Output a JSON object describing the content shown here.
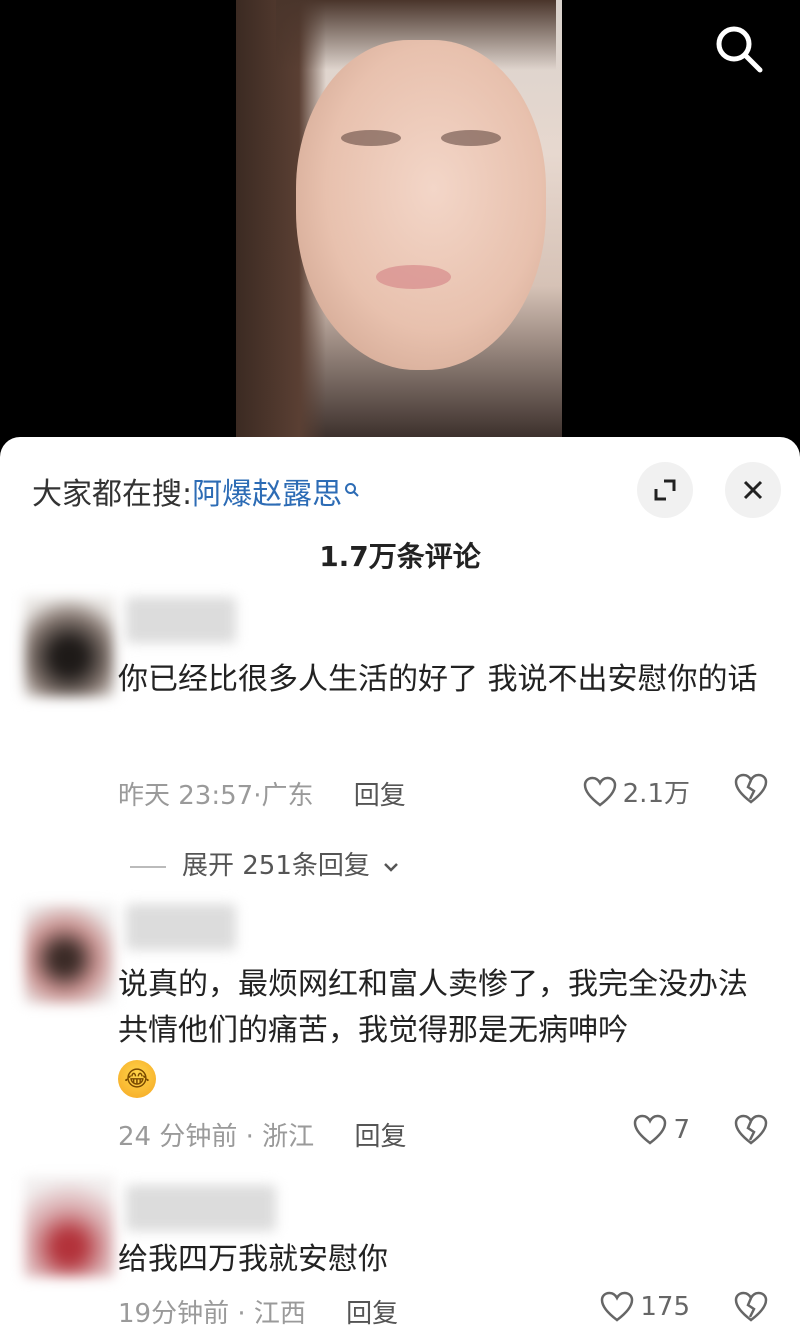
{
  "hot_search": {
    "prefix": "大家都在搜:",
    "keyword": "阿爆赵露思"
  },
  "comment_count": "1.7万条评论",
  "comments": [
    {
      "text": "你已经比很多人生活的好了 我说不出安慰你的话",
      "time": "昨天 23:57",
      "location": "广东",
      "reply_label": "回复",
      "likes": "2.1万",
      "expand_label": "展开 251条回复"
    },
    {
      "text": "说真的，最烦网红和富人卖惨了，我完全没办法共情他们的痛苦，我觉得那是无病呻吟",
      "emoji": "😂",
      "time": "24 分钟前",
      "location": "浙江",
      "reply_label": "回复",
      "likes": "7"
    },
    {
      "text": "给我四万我就安慰你",
      "time": "19分钟前",
      "location": "江西",
      "reply_label": "回复",
      "likes": "175"
    }
  ],
  "icons": {
    "search": "search-icon",
    "expand": "expand-icon",
    "close": "close-icon",
    "like": "heart-outline-icon",
    "dislike": "broken-heart-icon",
    "chevron": "chevron-down-icon"
  },
  "colors": {
    "link": "#2d6cb5",
    "meta": "#9a9a9a",
    "sheet": "#ffffff"
  }
}
